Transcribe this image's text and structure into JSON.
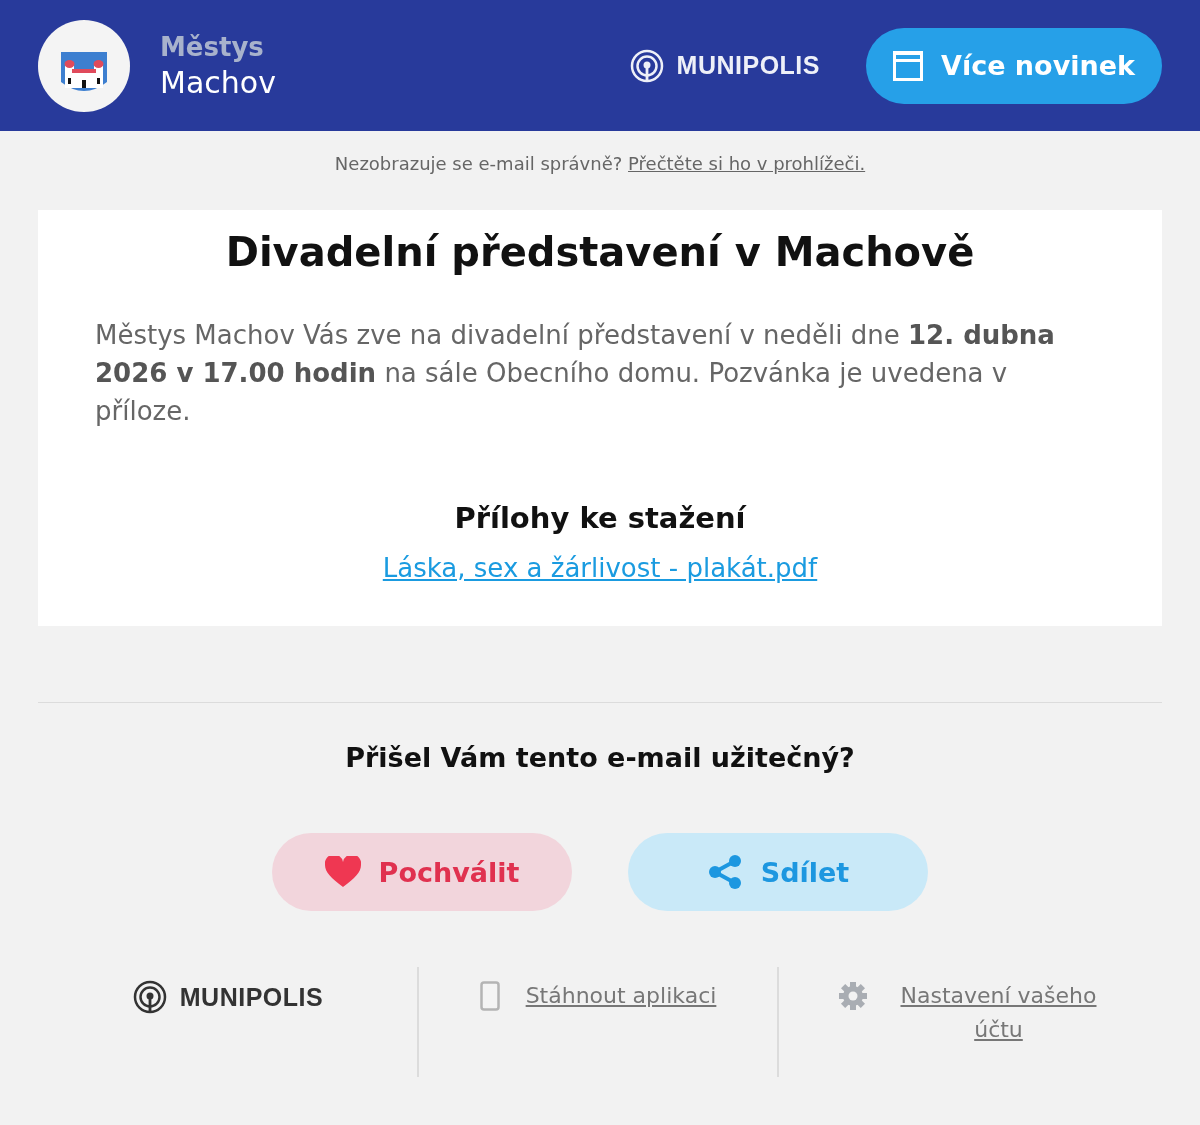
{
  "header": {
    "town_kind": "Městys",
    "town_name": "Machov",
    "brand": "MUNIPOLIS",
    "more_button": "Více novinek"
  },
  "notice": {
    "text": "Nezobrazuje se e-mail správně?",
    "link": "Přečtěte si ho v prohlížeči."
  },
  "article": {
    "title": "Divadelní představení v Machově",
    "body": "Městys Machov Vás zve na divadelní představení v neděli dne **12. dubna 2026 v 17.00 hodin** na sále Obecního domu. Pozvánka je uvedena v příloze.",
    "attachments_heading": "Přílohy ke stažení",
    "attachments": [
      "Láska, sex a žárlivost - plakát.pdf"
    ]
  },
  "feedback": {
    "question": "Přišel Vám tento e-mail užitečný?",
    "buttons": [
      {
        "kind": "like",
        "label": "Pochválit"
      },
      {
        "kind": "share",
        "label": "Sdílet"
      }
    ]
  },
  "footer": {
    "brand": "MUNIPOLIS",
    "links": [
      {
        "kind": "app",
        "label": "Stáhnout aplikaci"
      },
      {
        "kind": "settings",
        "label": "Nastavení vašeho účtu"
      }
    ]
  }
}
